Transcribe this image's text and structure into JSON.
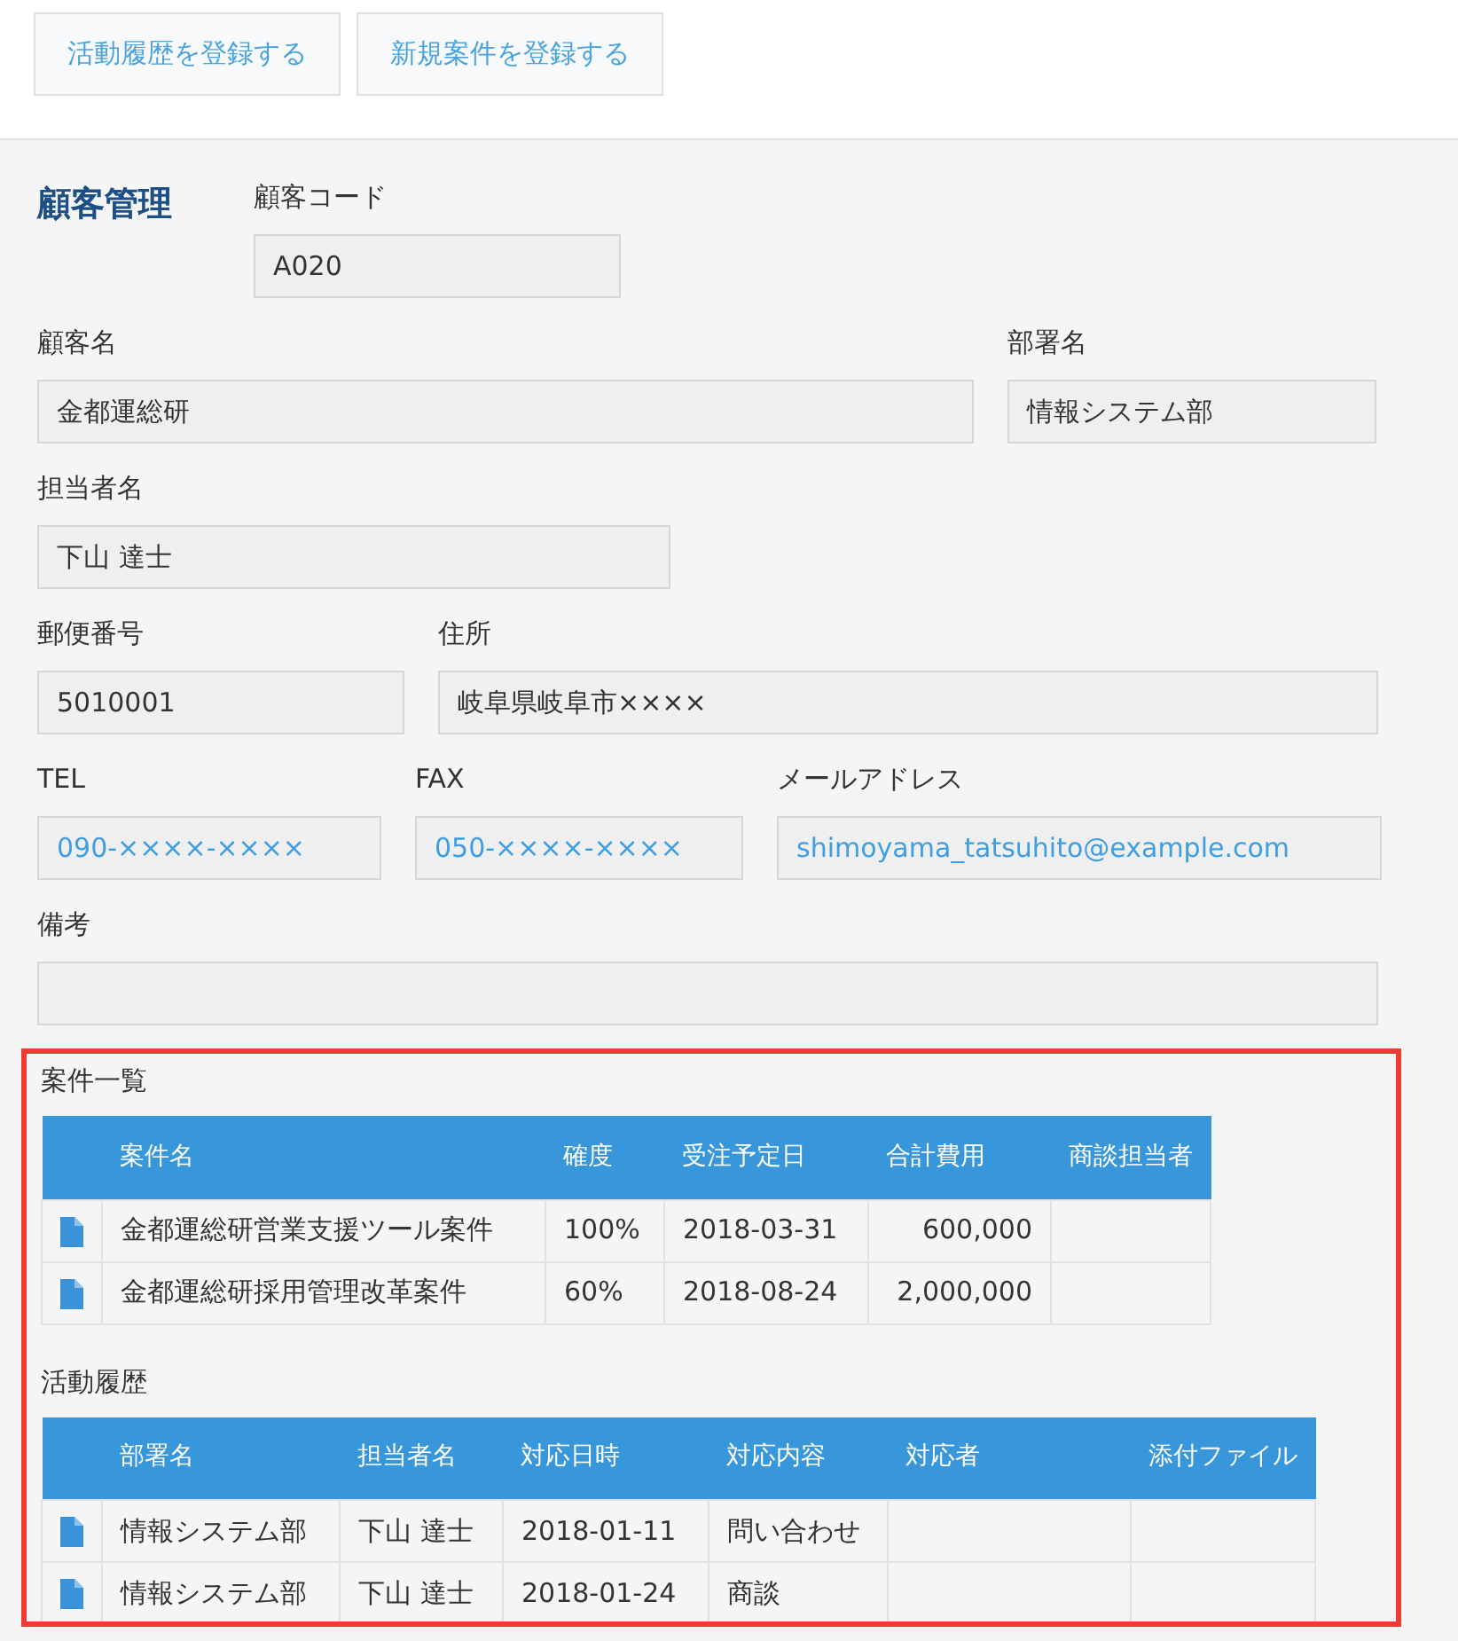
{
  "toolbar": {
    "buttons": [
      "活動履歴を登録する",
      "新規案件を登録する"
    ]
  },
  "form": {
    "title": "顧客管理",
    "fields": [
      {
        "label": "顧客コード",
        "value": "A020",
        "kind": "text"
      },
      {
        "label": "顧客名",
        "value": "金都運総研",
        "kind": "text"
      },
      {
        "label": "部署名",
        "value": "情報システム部",
        "kind": "text"
      },
      {
        "label": "担当者名",
        "value": "下山 達士",
        "kind": "text"
      },
      {
        "label": "郵便番号",
        "value": "5010001",
        "kind": "text"
      },
      {
        "label": "住所",
        "value": "岐阜県岐阜市××××",
        "kind": "text"
      },
      {
        "label": "TEL",
        "value": "090-××××-××××",
        "kind": "link"
      },
      {
        "label": "FAX",
        "value": "050-××××-××××",
        "kind": "link"
      },
      {
        "label": "メールアドレス",
        "value": "shimoyama_tatsuhito@example.com",
        "kind": "link"
      },
      {
        "label": "備考",
        "kind": "text"
      }
    ]
  },
  "related": {
    "highlighted": true,
    "tables": [
      {
        "title": "案件一覧",
        "columns": [
          "案件名",
          "確度",
          "受注予定日",
          "合計費用",
          "商談担当者"
        ],
        "rows": [
          [
            "金都運総研営業支援ツール案件",
            "100%",
            "2018-03-31",
            "600,000"
          ],
          [
            "金都運総研採用管理改革案件",
            "60%",
            "2018-08-24",
            "2,000,000"
          ]
        ]
      },
      {
        "title": "活動履歴",
        "columns": [
          "部署名",
          "担当者名",
          "対応日時",
          "対応内容",
          "対応者",
          "添付ファイル"
        ],
        "rows": [
          [
            "情報システム部",
            "下山 達士",
            "2018-01-11",
            "問い合わせ"
          ],
          [
            "情報システム部",
            "下山 達士",
            "2018-01-24",
            "商談"
          ]
        ]
      }
    ]
  }
}
